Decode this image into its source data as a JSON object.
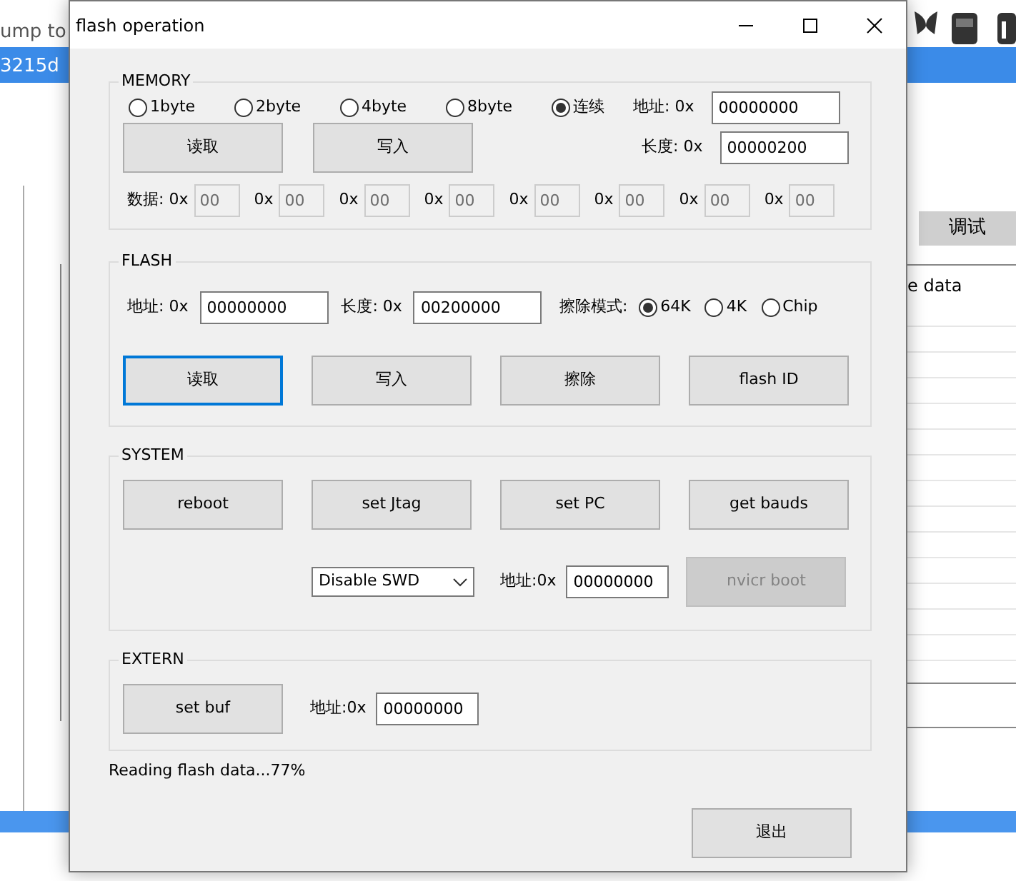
{
  "background_app": {
    "top_text": "ump to",
    "tab_text": "3215d",
    "debug_button": "调试",
    "column_text": "e data"
  },
  "dialog": {
    "title": "flash operation",
    "memory": {
      "title": "MEMORY",
      "options": [
        {
          "label": "1byte",
          "selected": false
        },
        {
          "label": "2byte",
          "selected": false
        },
        {
          "label": "4byte",
          "selected": false
        },
        {
          "label": "8byte",
          "selected": false
        },
        {
          "label": "连续",
          "selected": true
        }
      ],
      "address_label": "地址: 0x",
      "address": "00000000",
      "length_label": "长度: 0x",
      "length": "00000200",
      "buttons": [
        "读取",
        "写入"
      ],
      "data": [
        {
          "label": "数据: 0x",
          "value": "00"
        },
        {
          "label": "0x",
          "value": "00"
        },
        {
          "label": "0x",
          "value": "00"
        },
        {
          "label": "0x",
          "value": "00"
        },
        {
          "label": "0x",
          "value": "00"
        },
        {
          "label": "0x",
          "value": "00"
        },
        {
          "label": "0x",
          "value": "00"
        },
        {
          "label": "0x",
          "value": "00"
        }
      ]
    },
    "flash": {
      "title": "FLASH",
      "address_label": "地址: 0x",
      "address": "00000000",
      "length_label": "长度: 0x",
      "length": "00200000",
      "erase_label": "擦除模式:",
      "erase_modes": [
        {
          "label": "64K",
          "selected": true
        },
        {
          "label": "4K",
          "selected": false
        },
        {
          "label": "Chip",
          "selected": false
        }
      ],
      "buttons": [
        {
          "label": "读取",
          "focused": true
        },
        {
          "label": "写入",
          "focused": false
        },
        {
          "label": "擦除",
          "focused": false
        },
        {
          "label": "flash ID",
          "focused": false
        }
      ]
    },
    "system": {
      "title": "SYSTEM",
      "buttons": [
        {
          "label": "reboot",
          "disabled": false
        },
        {
          "label": "set Jtag",
          "disabled": false
        },
        {
          "label": "set PC",
          "disabled": false
        },
        {
          "label": "get bauds",
          "disabled": false
        }
      ],
      "swd_select": "Disable SWD",
      "address_label": "地址:0x",
      "address": "00000000",
      "boot_button": {
        "label": "nvicr boot",
        "disabled": true
      }
    },
    "extern": {
      "title": "EXTERN",
      "button": "set buf",
      "address_label": "地址:0x",
      "address": "00000000"
    },
    "status": "Reading flash data...77%",
    "exit_button": "退出"
  }
}
